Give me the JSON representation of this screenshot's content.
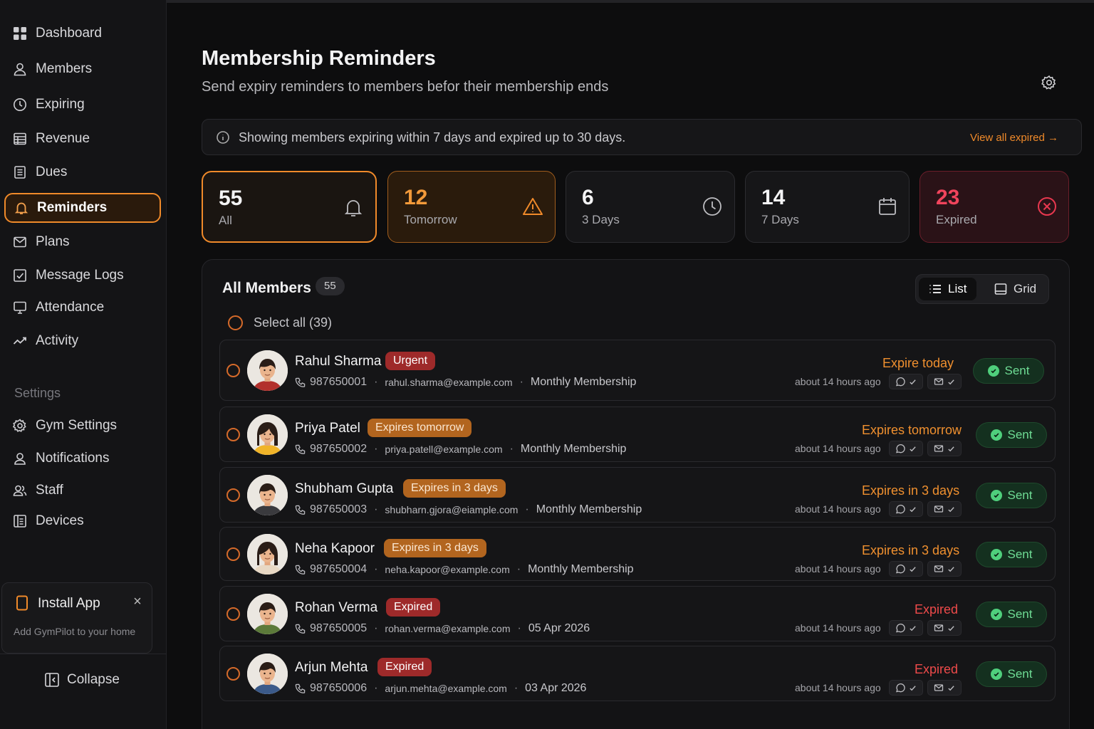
{
  "sidebar": {
    "items": [
      {
        "label": "Dashboard",
        "icon": "grid-icon"
      },
      {
        "label": "Members",
        "icon": "user-icon"
      },
      {
        "label": "Expiring",
        "icon": "clock-icon"
      },
      {
        "label": "Revenue",
        "icon": "ledger-icon"
      },
      {
        "label": "Dues",
        "icon": "document-icon"
      },
      {
        "label": "Reminders",
        "icon": "bell-icon"
      },
      {
        "label": "Plans",
        "icon": "mail-icon"
      },
      {
        "label": "Message Logs",
        "icon": "check-square-icon"
      },
      {
        "label": "Attendance",
        "icon": "monitor-icon"
      },
      {
        "label": "Activity",
        "icon": "trend-icon"
      }
    ],
    "settings_label": "Settings",
    "settings_items": [
      {
        "label": "Gym Settings",
        "icon": "gear-icon"
      },
      {
        "label": "Notifications",
        "icon": "user-badge-icon"
      },
      {
        "label": "Staff",
        "icon": "users-icon"
      },
      {
        "label": "Devices",
        "icon": "devices-icon"
      }
    ],
    "install": {
      "title": "Install App",
      "subtitle": "Add GymPilot to your home",
      "close": "×"
    },
    "collapse_label": "Collapse"
  },
  "header": {
    "title": "Membership Reminders",
    "subtitle": "Send expiry reminders to members befor their membership ends"
  },
  "info": {
    "text": "Showing members expiring within 7 days and expired up to 30 days.",
    "link": "View all expired →"
  },
  "stats": [
    {
      "value": "55",
      "label": "All"
    },
    {
      "value": "12",
      "label": "Tomorrow"
    },
    {
      "value": "6",
      "label": "3 Days"
    },
    {
      "value": "14",
      "label": "7 Days"
    },
    {
      "value": "23",
      "label": "Expired"
    }
  ],
  "panel": {
    "title": "All Members",
    "count": "55",
    "view_list": "List",
    "view_grid": "Grid",
    "select_all": "Select all (39)"
  },
  "members": [
    {
      "name": "Rahul Sharma",
      "badge": "Urgent",
      "phone": "987650001",
      "email": "rahul.sharma@example.com",
      "plan": "Monthly Membership",
      "status": "Expire today",
      "ago": "about 14 hours ago",
      "action": "Sent"
    },
    {
      "name": "Priya Patel",
      "badge": "Expires tomorrow",
      "phone": "987650002",
      "email": "priya.patell@example.com",
      "plan": "Monthly Membership",
      "status": "Expires tomorrow",
      "ago": "about 14 hours ago",
      "action": "Sent"
    },
    {
      "name": "Shubham Gupta",
      "badge": "Expires in 3 days",
      "phone": "987650003",
      "email": "shubharn.gjora@eiample.com",
      "plan": "Monthly Membership",
      "status": "Expires in 3 days",
      "ago": "about 14 hours ago",
      "action": "Sent"
    },
    {
      "name": "Neha Kapoor",
      "badge": "Expires in 3 days",
      "phone": "987650004",
      "email": "neha.kapoor@example.com",
      "plan": "Monthly Membership",
      "status": "Expires in 3 days",
      "ago": "about 14 hours ago",
      "action": "Sent"
    },
    {
      "name": "Rohan Verma",
      "badge": "Expired",
      "phone": "987650005",
      "email": "rohan.verma@example.com",
      "plan": "05 Apr 2026",
      "status": "Expired",
      "ago": "about 14 hours ago",
      "action": "Sent"
    },
    {
      "name": "Arjun Mehta",
      "badge": "Expired",
      "phone": "987650006",
      "email": "arjun.mehta@example.com",
      "plan": "03 Apr 2026",
      "status": "Expired",
      "ago": "about 14 hours ago",
      "action": "Sent"
    }
  ],
  "colors": {
    "accent": "#f08a2a",
    "danger": "#ee4a4a",
    "success": "#4fcf7c"
  }
}
